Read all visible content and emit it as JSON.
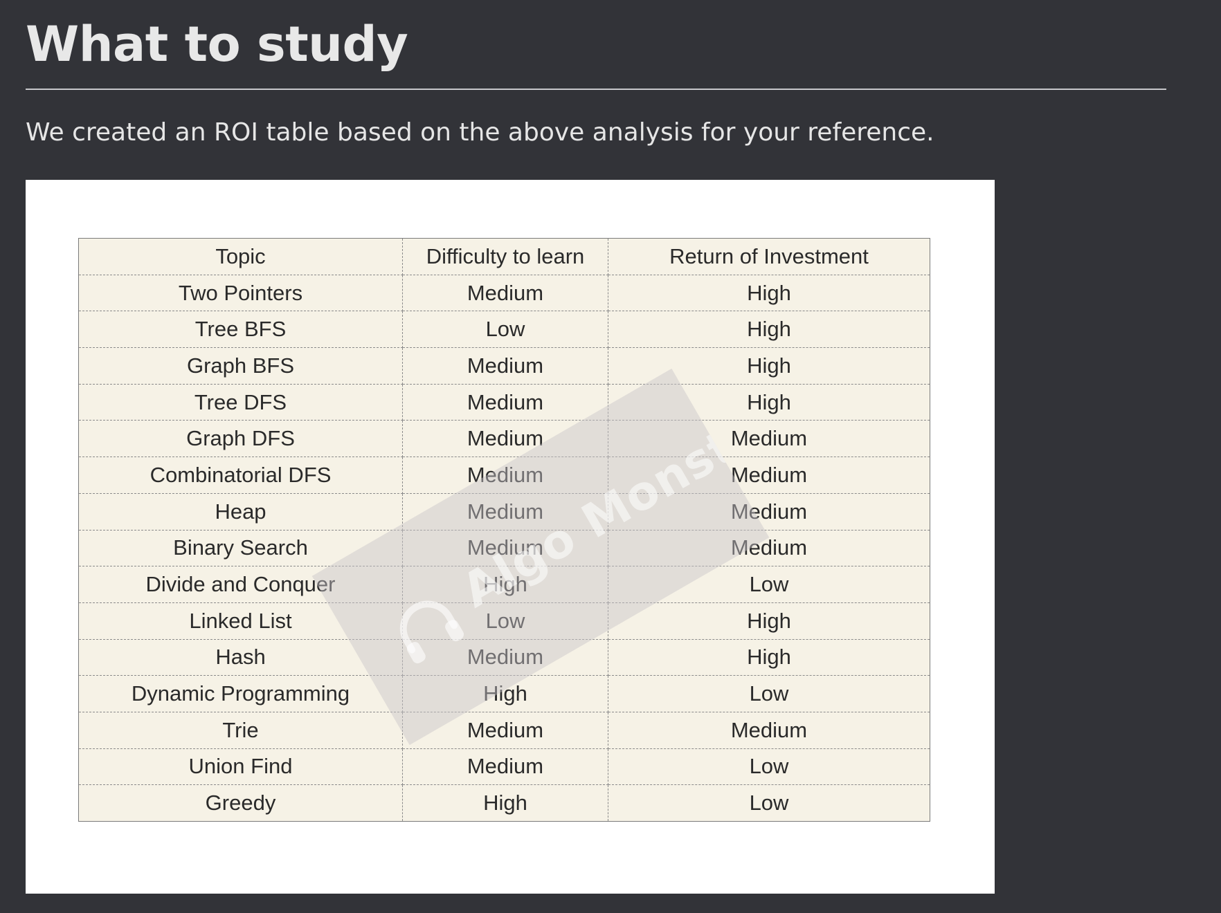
{
  "page": {
    "title": "What to study",
    "intro": "We created an ROI table based on the above analysis for your reference."
  },
  "table": {
    "headers": [
      "Topic",
      "Difficulty to learn",
      "Return of Investment"
    ],
    "rows": [
      [
        "Two Pointers",
        "Medium",
        "High"
      ],
      [
        "Tree BFS",
        "Low",
        "High"
      ],
      [
        "Graph BFS",
        "Medium",
        "High"
      ],
      [
        "Tree DFS",
        "Medium",
        "High"
      ],
      [
        "Graph DFS",
        "Medium",
        "Medium"
      ],
      [
        "Combinatorial DFS",
        "Medium",
        "Medium"
      ],
      [
        "Heap",
        "Medium",
        "Medium"
      ],
      [
        "Binary Search",
        "Medium",
        "Medium"
      ],
      [
        "Divide and Conquer",
        "High",
        "Low"
      ],
      [
        "Linked List",
        "Low",
        "High"
      ],
      [
        "Hash",
        "Medium",
        "High"
      ],
      [
        "Dynamic Programming",
        "High",
        "Low"
      ],
      [
        "Trie",
        "Medium",
        "Medium"
      ],
      [
        "Union Find",
        "Medium",
        "Low"
      ],
      [
        "Greedy",
        "High",
        "Low"
      ]
    ]
  },
  "watermark": {
    "text": "Algo Monster",
    "icon": "headphones-icon"
  },
  "colors": {
    "page_background": "#323338",
    "heading_text": "#e8e8e8",
    "table_background": "#f6f2e6"
  }
}
